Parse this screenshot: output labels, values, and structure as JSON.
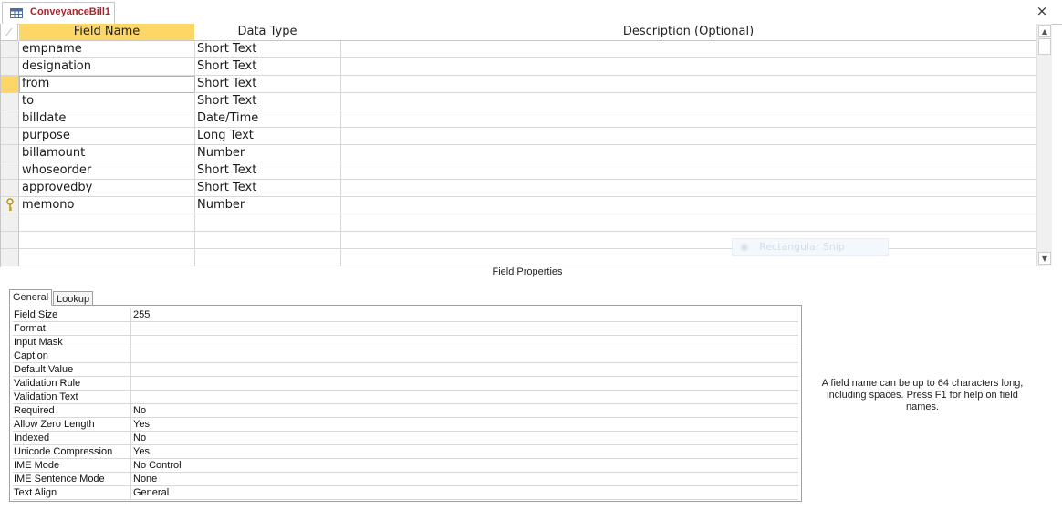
{
  "window": {
    "tab_title": "ConveyanceBill1",
    "close_glyph": "×"
  },
  "grid": {
    "columns": [
      "Field Name",
      "Data Type",
      "Description (Optional)"
    ],
    "rows": [
      {
        "name": "empname",
        "type": "Short Text"
      },
      {
        "name": "designation",
        "type": "Short Text"
      },
      {
        "name": "from",
        "type": "Short Text"
      },
      {
        "name": "to",
        "type": "Short Text"
      },
      {
        "name": "billdate",
        "type": "Date/Time"
      },
      {
        "name": "purpose",
        "type": "Long Text"
      },
      {
        "name": "billamount",
        "type": "Number"
      },
      {
        "name": "whoseorder",
        "type": "Short Text"
      },
      {
        "name": "approvedby",
        "type": "Short Text"
      },
      {
        "name": "memono",
        "type": "Number"
      }
    ],
    "primary_key_row": "memono",
    "active_row": "from",
    "icons": {
      "primary_key": "key-icon",
      "tab": "table-icon"
    }
  },
  "overlay": {
    "ghost_label": "Rectangular Snip"
  },
  "field_properties": {
    "title": "Field Properties",
    "tabs": [
      "General",
      "Lookup"
    ],
    "active_tab": "General",
    "properties": [
      {
        "label": "Field Size",
        "value": "255"
      },
      {
        "label": "Format",
        "value": ""
      },
      {
        "label": "Input Mask",
        "value": ""
      },
      {
        "label": "Caption",
        "value": ""
      },
      {
        "label": "Default Value",
        "value": ""
      },
      {
        "label": "Validation Rule",
        "value": ""
      },
      {
        "label": "Validation Text",
        "value": ""
      },
      {
        "label": "Required",
        "value": "No"
      },
      {
        "label": "Allow Zero Length",
        "value": "Yes"
      },
      {
        "label": "Indexed",
        "value": "No"
      },
      {
        "label": "Unicode Compression",
        "value": "Yes"
      },
      {
        "label": "IME Mode",
        "value": "No Control"
      },
      {
        "label": "IME Sentence Mode",
        "value": "None"
      },
      {
        "label": "Text Align",
        "value": "General"
      }
    ],
    "help_text": "A field name can be up to 64 characters long, including spaces. Press F1 for help on field names."
  },
  "colors": {
    "tab_title": "#a4262c",
    "header_highlight": "#fcd666",
    "active_cell_border": "#e8a0a0",
    "selector_active": "#fcd666"
  }
}
